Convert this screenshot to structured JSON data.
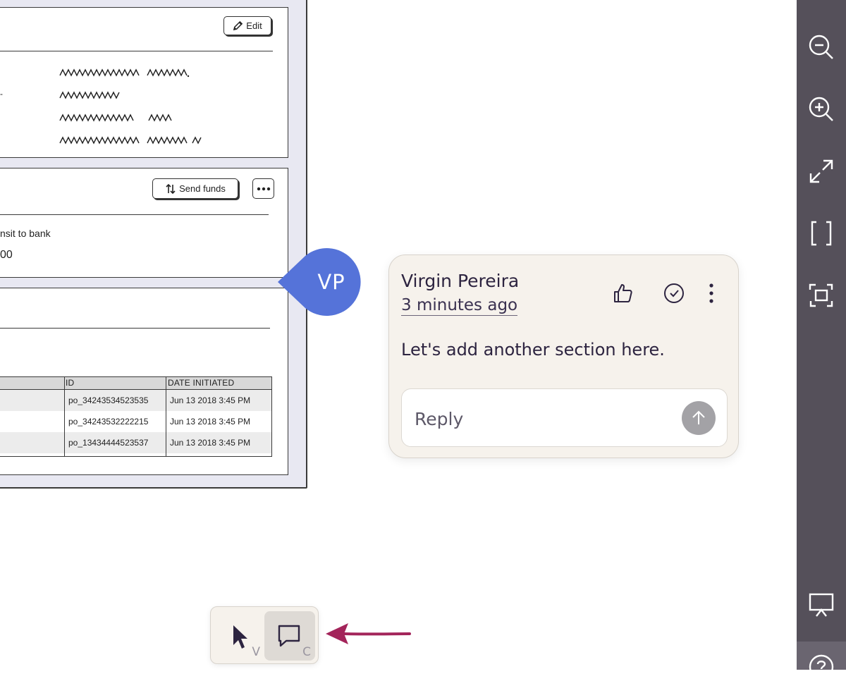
{
  "wireframe": {
    "edit_label": "Edit",
    "send_funds_label": "Send funds",
    "transit_text": "nsit to bank",
    "amount_text": "00",
    "table": {
      "headers": [
        "ID",
        "DATE INITIATED"
      ],
      "rows": [
        {
          "id": "po_34243534523535",
          "date": "Jun 13 2018 3:45 PM"
        },
        {
          "id": "po_34243532222215",
          "date": "Jun 13 2018 3:45 PM"
        },
        {
          "id": "po_13434444523537",
          "date": "Jun 13 2018 3:45 PM"
        }
      ]
    }
  },
  "avatar": {
    "initials": "VP",
    "color": "#5573d9"
  },
  "comment": {
    "author": "Virgin Pereira",
    "time": "3 minutes ago",
    "body": "Let's add another section here.",
    "reply_placeholder": "Reply",
    "icons": [
      "thumbs-up-icon",
      "resolve-check-icon",
      "more-vertical-icon",
      "send-arrow-icon"
    ]
  },
  "rail": {
    "icons": [
      "zoom-out-icon",
      "zoom-in-icon",
      "fullscreen-icon",
      "fit-brackets-icon",
      "focus-frame-icon",
      "present-icon",
      "help-icon"
    ]
  },
  "toolbar": {
    "select_key": "V",
    "comment_key": "C",
    "active_tool": "comment"
  },
  "colors": {
    "accent_annotation": "#a3245a",
    "rail_bg": "#55505a",
    "card_bg": "#f6f2ec"
  }
}
